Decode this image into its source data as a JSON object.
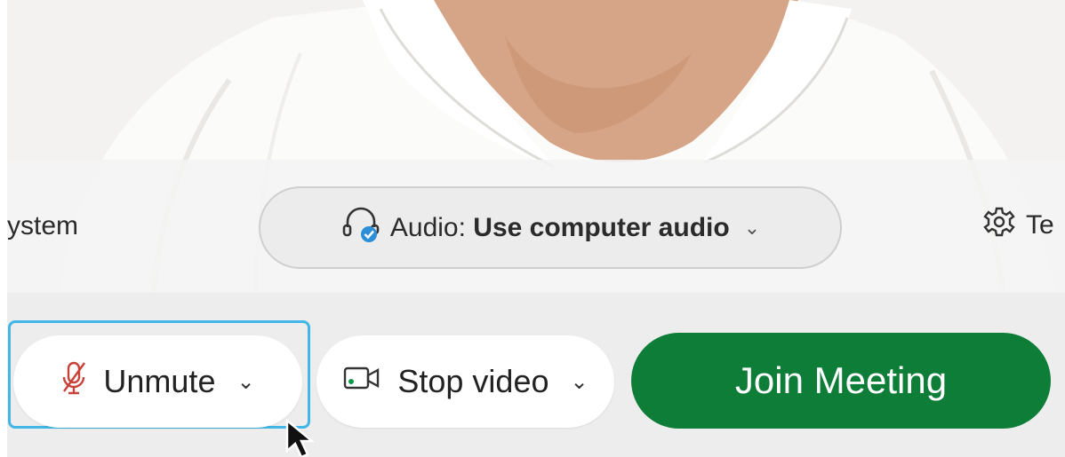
{
  "settings_row": {
    "left_partial_label": "ystem",
    "audio": {
      "prefix": "Audio:",
      "value": "Use computer audio",
      "icon": "headset-check-icon",
      "chevron": "⌄"
    },
    "test": {
      "icon": "gear-icon",
      "partial_label": "Te"
    }
  },
  "controls": {
    "unmute": {
      "label": "Unmute",
      "icon": "muted-microphone-icon",
      "chevron": "⌄"
    },
    "stop_video": {
      "label": "Stop video",
      "icon": "video-camera-icon",
      "chevron": "⌄"
    },
    "join": {
      "label": "Join Meeting"
    }
  },
  "colors": {
    "join_green": "#0e7d38",
    "focus_ring": "#42b6e6",
    "muted_red": "#c9423a",
    "check_blue": "#2d8ed8"
  }
}
